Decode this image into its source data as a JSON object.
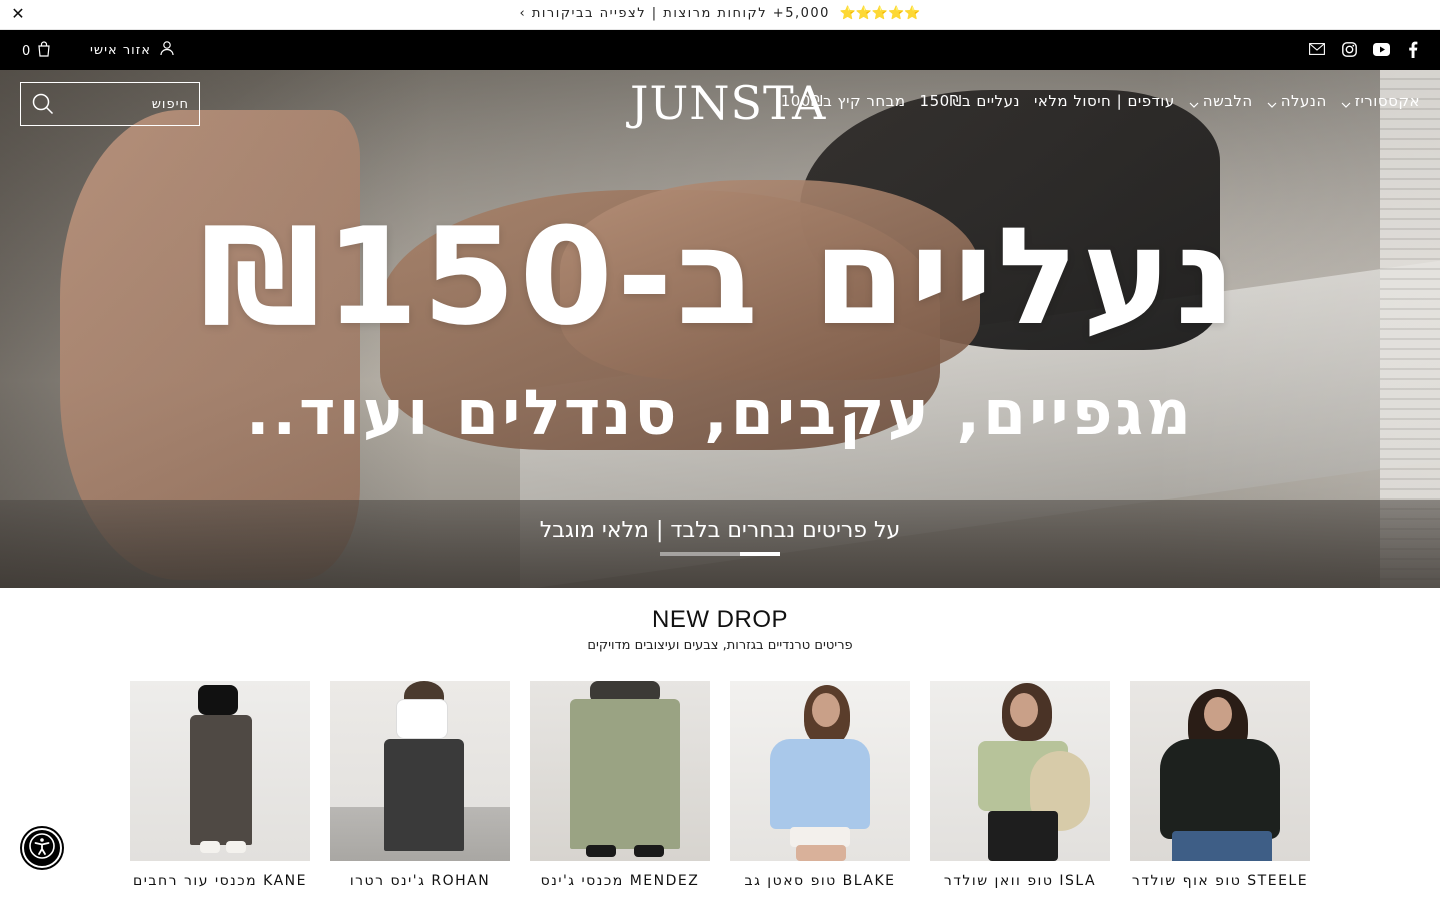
{
  "announcement": {
    "stars": "⭐⭐⭐⭐⭐",
    "text": "5,000+ לקוחות מרוצות | לצפייה בביקורות ›",
    "close": "✕"
  },
  "topbar": {
    "cart_count": "0",
    "account_label": "אזור אישי",
    "social_icons": [
      "facebook-icon",
      "youtube-icon",
      "instagram-icon",
      "mail-icon"
    ]
  },
  "header": {
    "logo": "JUNSTA",
    "search_placeholder": "חיפוש",
    "nav": [
      {
        "label": "מבחר קיץ ב100₪",
        "dropdown": false
      },
      {
        "label": "נעליים ב150₪",
        "dropdown": false
      },
      {
        "label": "עודפים | חיסול מלאי",
        "dropdown": false
      },
      {
        "label": "הלבשה",
        "dropdown": true
      },
      {
        "label": "הנעלה",
        "dropdown": true
      },
      {
        "label": "אקססוריז",
        "dropdown": true
      }
    ]
  },
  "hero": {
    "title": "נעליים ב-₪150",
    "subtitle": "מגפיים, עקבים, סנדלים ועוד..",
    "note": "על פריטים נבחרים בלבד | מלאי מוגבל",
    "slides": 3,
    "active_slide": 3
  },
  "new_drop": {
    "title": "NEW DROP",
    "subtitle": "פריטים טרנדיים בגזרות, צבעים ועיצובים מדויקים",
    "products": [
      {
        "name": "STEELE טופ אוף שולדר"
      },
      {
        "name": "ISLA טופ וואן שולדר"
      },
      {
        "name": "BLAKE טופ סאטן גב"
      },
      {
        "name": "MENDEZ מכנסי ג'ינס"
      },
      {
        "name": "ROHAN ג'ינס רטרו"
      },
      {
        "name": "KANE מכנסי עור רחבים"
      }
    ]
  },
  "colors": {
    "accent": "#000000",
    "star": "#f4b400",
    "hero_text": "#ffffff"
  }
}
